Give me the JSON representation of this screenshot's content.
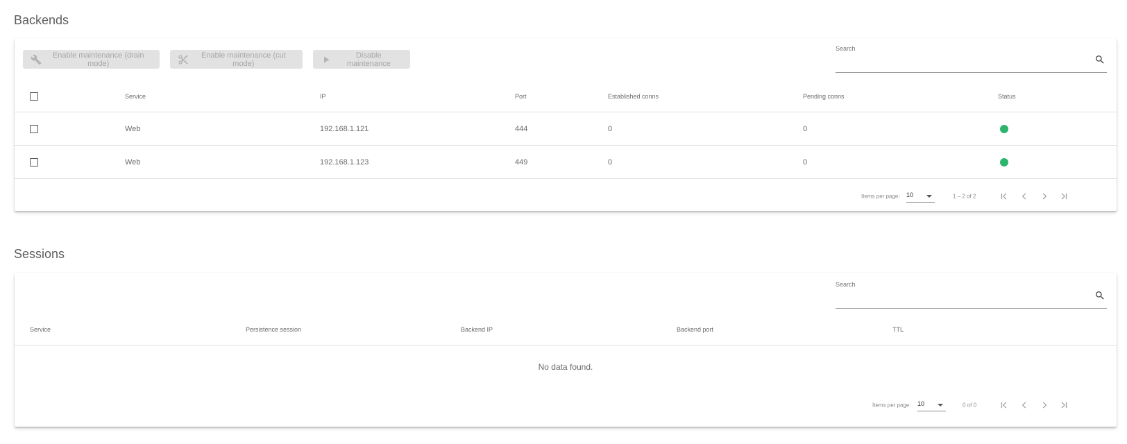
{
  "backends": {
    "title": "Backends",
    "toolbar": {
      "drain_label": "Enable maintenance (drain mode)",
      "cut_label": "Enable maintenance (cut mode)",
      "disable_label": "Disable maintenance"
    },
    "search": {
      "label": "Search",
      "value": ""
    },
    "columns": {
      "service": "Service",
      "ip": "IP",
      "port": "Port",
      "established": "Established conns",
      "pending": "Pending conns",
      "status": "Status"
    },
    "rows": [
      {
        "service": "Web",
        "ip": "192.168.1.121",
        "port": "444",
        "established": "0",
        "pending": "0",
        "status": "up"
      },
      {
        "service": "Web",
        "ip": "192.168.1.123",
        "port": "449",
        "established": "0",
        "pending": "0",
        "status": "up"
      }
    ],
    "paginator": {
      "items_label": "Items per page:",
      "page_size": "10",
      "range": "1 – 2 of 2"
    }
  },
  "sessions": {
    "title": "Sessions",
    "search": {
      "label": "Search",
      "value": ""
    },
    "columns": {
      "service": "Service",
      "persistence": "Persistence session",
      "backend_ip": "Backend IP",
      "backend_port": "Backend port",
      "ttl": "TTL"
    },
    "empty_text": "No data found.",
    "paginator": {
      "items_label": "Items per page:",
      "page_size": "10",
      "range": "0 of 0"
    }
  },
  "colors": {
    "status_up": "#2db46d",
    "button_bg": "#e2e2e2",
    "button_text": "#a6a6a6"
  }
}
